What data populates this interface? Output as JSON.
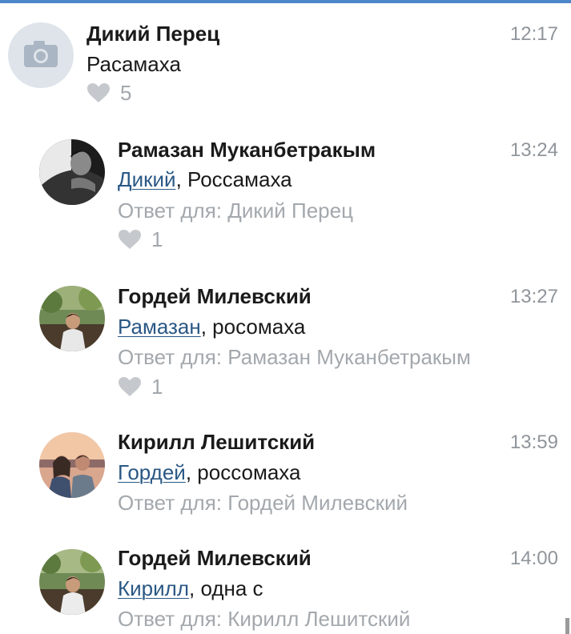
{
  "comments": [
    {
      "author": "Дикий Перец",
      "time": "12:17",
      "mention": "",
      "text": "Расамаха",
      "reply_to": "",
      "likes": "5",
      "avatar": "camera-placeholder"
    },
    {
      "author": "Рамазан Муканбетракым",
      "time": "13:24",
      "mention": "Дикий",
      "text": ", Россамаха",
      "reply_to": "Ответ для: Дикий Перец",
      "likes": "1",
      "avatar": "photo"
    },
    {
      "author": "Гордей Милевский",
      "time": "13:27",
      "mention": "Рамазан",
      "text": ", росомаха",
      "reply_to": "Ответ для: Рамазан Муканбетракым",
      "likes": "1",
      "avatar": "photo"
    },
    {
      "author": "Кирилл Лешитский",
      "time": "13:59",
      "mention": "Гордей",
      "text": ", россомаха",
      "reply_to": "Ответ для: Гордей Милевский",
      "likes": "",
      "avatar": "photo"
    },
    {
      "author": "Гордей Милевский",
      "time": "14:00",
      "mention": "Кирилл",
      "text": ", одна с",
      "reply_to": "Ответ для: Кирилл Лешитский",
      "likes": "",
      "avatar": "photo"
    }
  ],
  "colors": {
    "accent": "#4d86c9",
    "mention": "#2a5885",
    "muted": "#a3a8ad"
  }
}
